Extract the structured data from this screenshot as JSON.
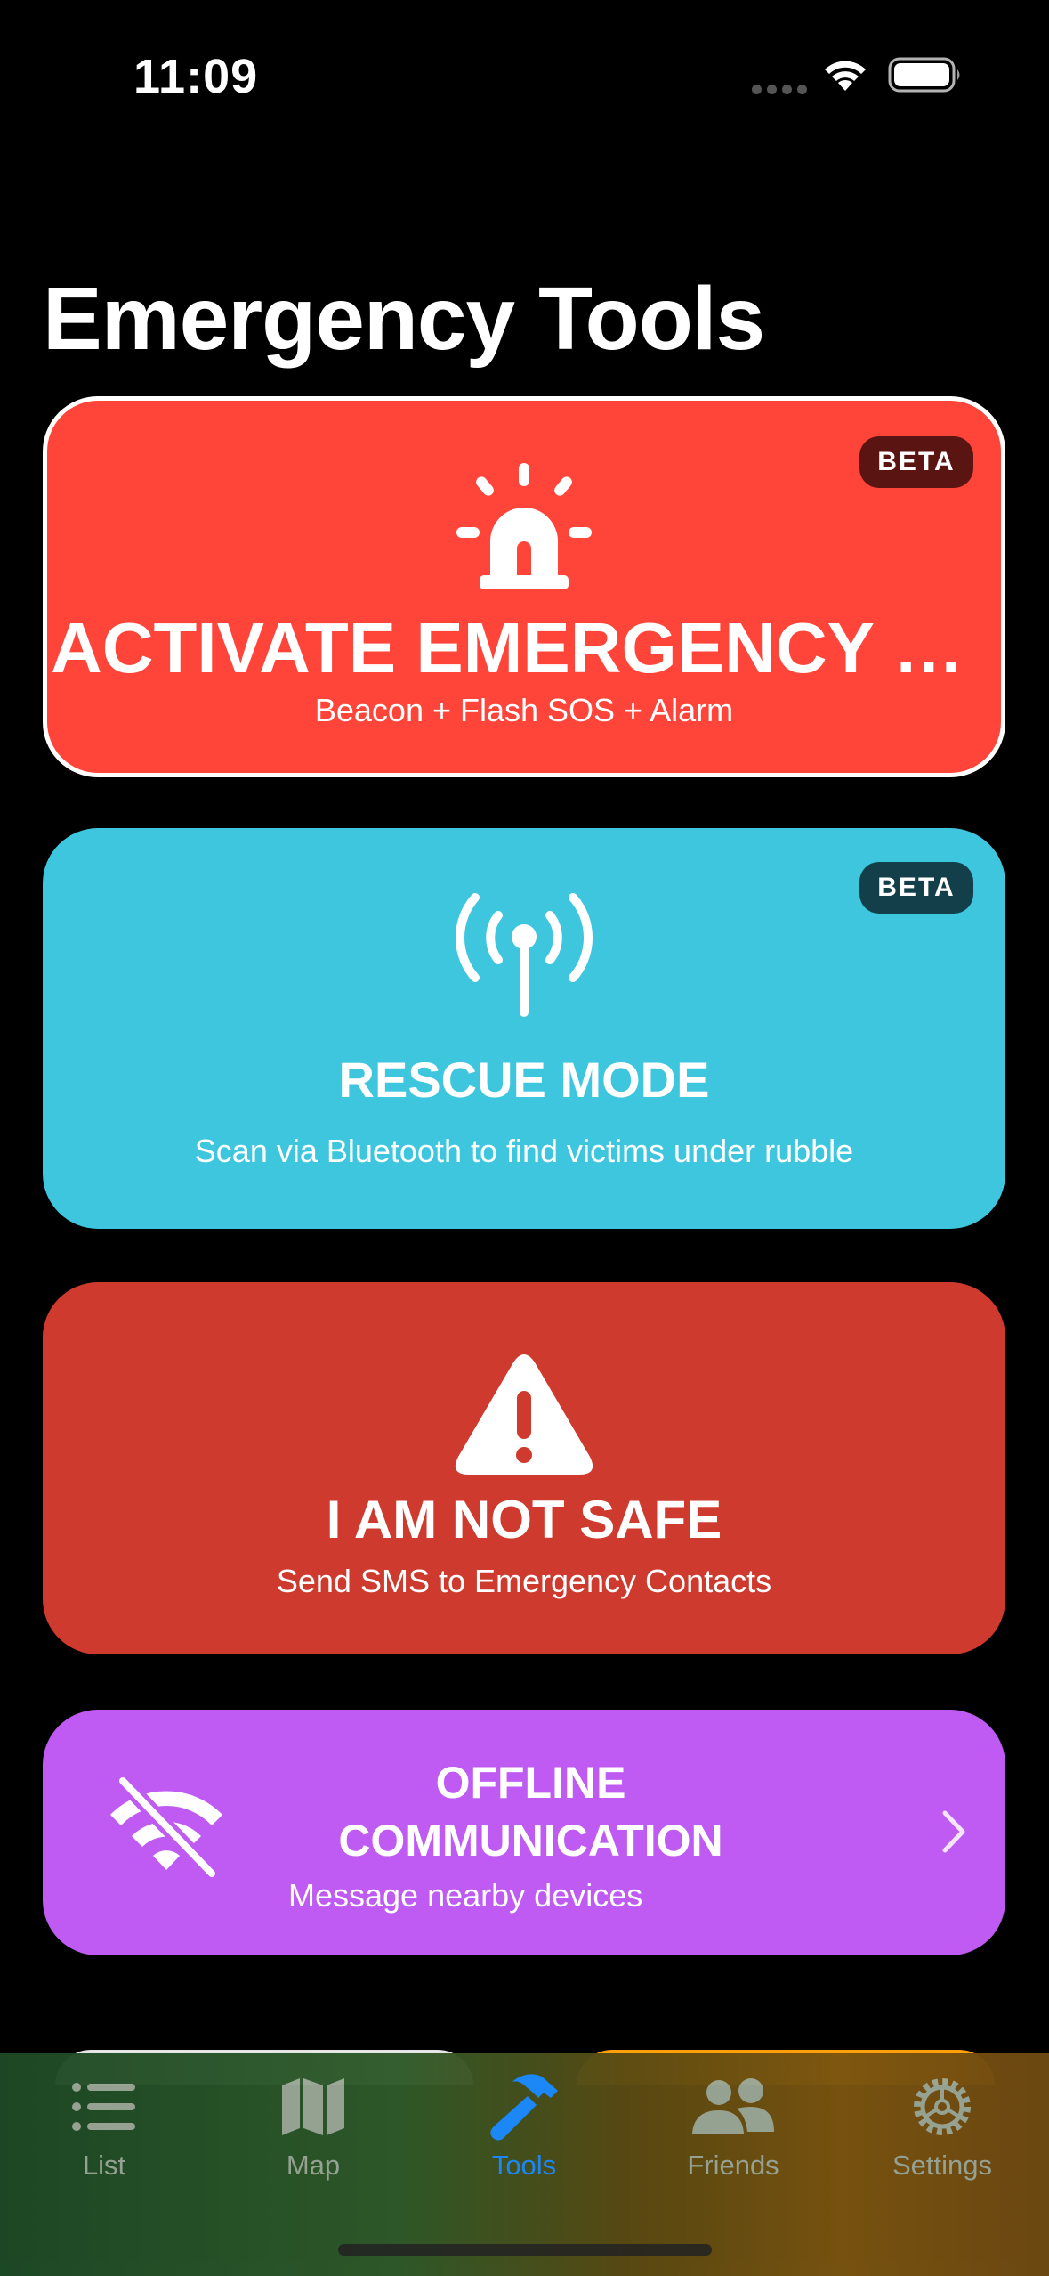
{
  "status_bar": {
    "time": "11:09"
  },
  "page": {
    "title": "Emergency Tools"
  },
  "cards": {
    "emergency": {
      "badge": "BETA",
      "title": "ACTIVATE EMERGENCY MODE",
      "title_display": "ACTIVATE EMERGENCY M…",
      "subtitle": "Beacon + Flash SOS + Alarm",
      "icon": "siren-icon"
    },
    "rescue": {
      "badge": "BETA",
      "title": "RESCUE MODE",
      "subtitle": "Scan via Bluetooth to find victims under rubble",
      "icon": "antenna-icon"
    },
    "not_safe": {
      "title": "I AM NOT SAFE",
      "subtitle": "Send SMS to Emergency Contacts",
      "icon": "warning-triangle-icon"
    },
    "offline": {
      "title_line1": "OFFLINE",
      "title_line2": "COMMUNICATION",
      "subtitle": "Message nearby devices",
      "icon": "wifi-off-icon"
    }
  },
  "tab_bar": {
    "active": "Tools",
    "items": [
      {
        "label": "List",
        "icon": "list-icon"
      },
      {
        "label": "Map",
        "icon": "map-icon"
      },
      {
        "label": "Tools",
        "icon": "hammer-icon"
      },
      {
        "label": "Friends",
        "icon": "people-icon"
      },
      {
        "label": "Settings",
        "icon": "gear-icon"
      }
    ]
  },
  "colors": {
    "emergency": "#ff453a",
    "rescue": "#3ec6df",
    "not_safe": "#cf3a2e",
    "offline": "#bf5af2",
    "tab_active": "#1d8cff"
  }
}
